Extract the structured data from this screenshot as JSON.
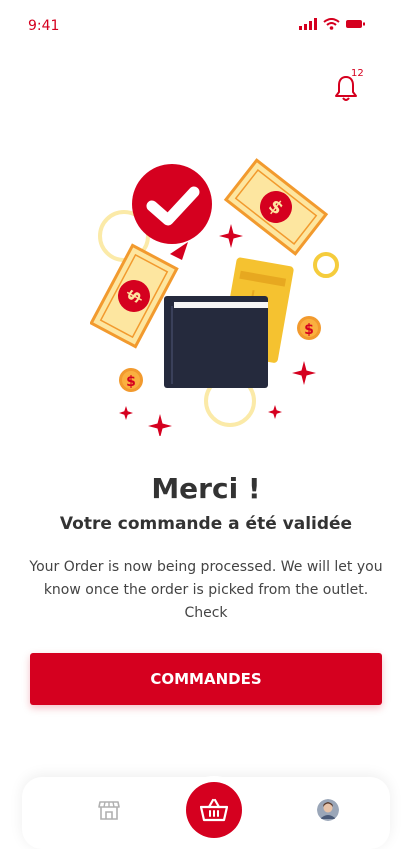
{
  "status": {
    "time": "9:41"
  },
  "header": {
    "notification_count": "12",
    "bell_icon": "bell-icon"
  },
  "content": {
    "title": "Merci !",
    "subtitle": "Votre commande a été validée",
    "message": "Your Order is now being processed. We will let you know once the order is picked from the outlet. Check"
  },
  "actions": {
    "orders_label": "COMMANDES"
  },
  "bottom_nav": {
    "items": [
      "store-icon",
      "basket-icon",
      "avatar"
    ]
  },
  "colors": {
    "accent": "#d5001f",
    "bill": "#fde6a0",
    "wallet": "#252a3d",
    "text": "#333333"
  }
}
